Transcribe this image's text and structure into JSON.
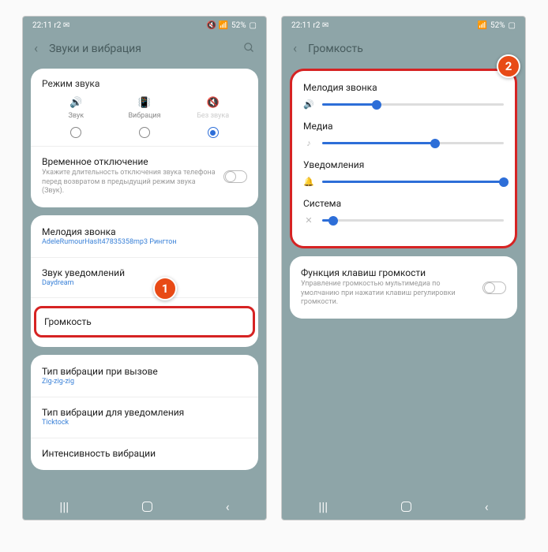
{
  "status": {
    "time": "22:11",
    "net": "r2",
    "battery": "52%"
  },
  "screen1": {
    "title": "Звуки и вибрация",
    "card_mode": {
      "title": "Режим звука",
      "modes": [
        "Звук",
        "Вибрация",
        "Без звука"
      ]
    },
    "tempoff": {
      "title": "Временное отключение",
      "desc": "Укажите длительность отключения звука телефона перед возвратом в предыдущий режим звука (Звук)."
    },
    "ringtone": {
      "title": "Мелодия звонка",
      "sub": "AdeleRumourHasIt47835358mp3 Рингтон"
    },
    "notif": {
      "title": "Звук уведомлений",
      "sub": "Daydream"
    },
    "volume": {
      "title": "Громкость"
    },
    "vibcall": {
      "title": "Тип вибрации при вызове",
      "sub": "Zig-zig-zig"
    },
    "vibnotif": {
      "title": "Тип вибрации для уведомления",
      "sub": "Ticktock"
    },
    "vibint": {
      "title": "Интенсивность вибрации"
    }
  },
  "screen2": {
    "title": "Громкость",
    "sliders": [
      {
        "label": "Мелодия звонка",
        "icon": "🔊",
        "value": 30
      },
      {
        "label": "Медиа",
        "icon": "♪",
        "value": 62
      },
      {
        "label": "Уведомления",
        "icon": "🔔",
        "value": 100
      },
      {
        "label": "Система",
        "icon": "✕",
        "value": 6
      }
    ],
    "volkey": {
      "title": "Функция клавиш громкости",
      "desc": "Управление громкостью мультимедиа по умолчанию при нажатии клавиш регулировки громкости."
    }
  },
  "markers": {
    "m1": "1",
    "m2": "2"
  }
}
